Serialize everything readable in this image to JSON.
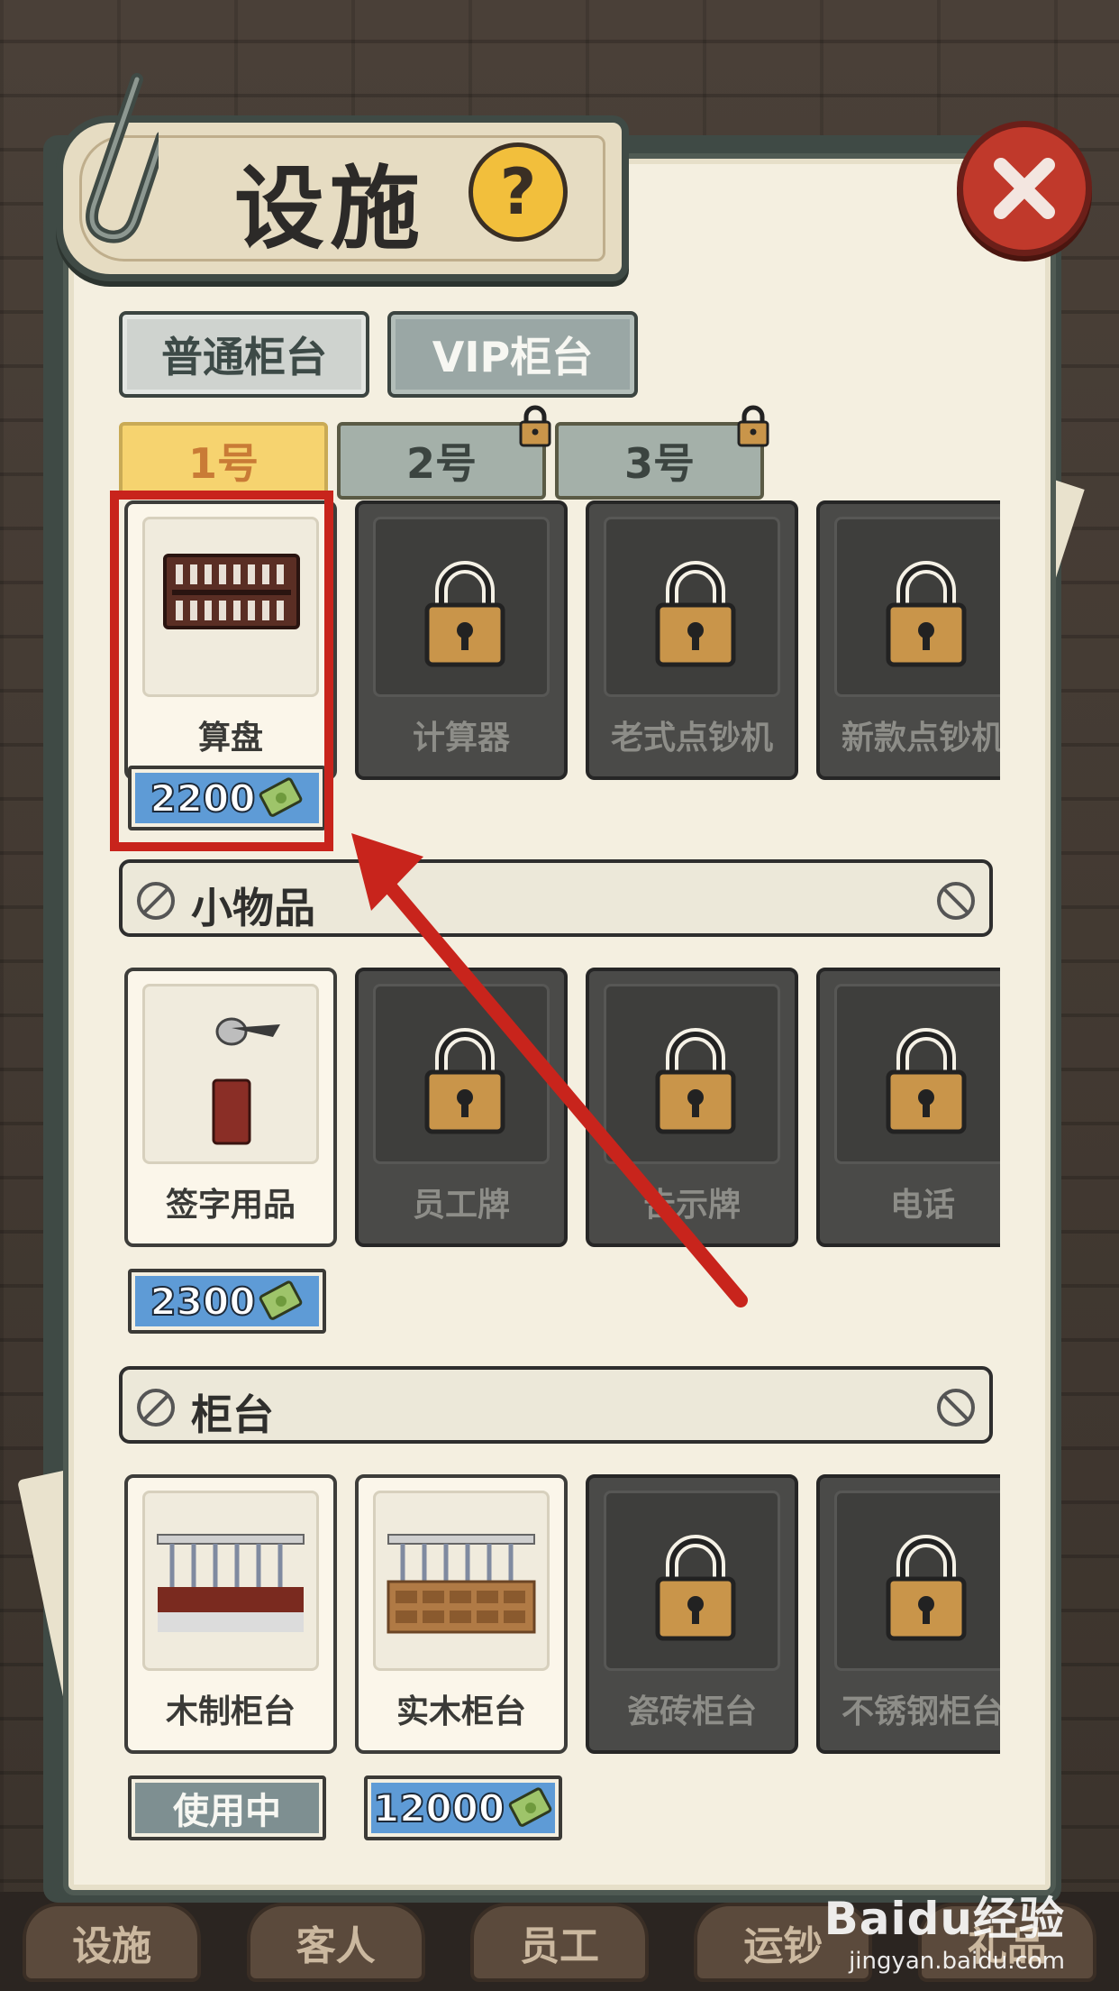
{
  "title": "设施",
  "help_label": "?",
  "category_tabs": [
    {
      "label": "普通柜台",
      "state": "selected"
    },
    {
      "label": "VIP柜台",
      "state": "unselected"
    }
  ],
  "counter_tabs": [
    {
      "label": "1号",
      "locked": false
    },
    {
      "label": "2号",
      "locked": true
    },
    {
      "label": "3号",
      "locked": true
    }
  ],
  "tools_row": {
    "items": [
      {
        "label": "算盘",
        "locked": false,
        "price": "2200"
      },
      {
        "label": "计算器",
        "locked": true
      },
      {
        "label": "老式点钞机",
        "locked": true
      },
      {
        "label": "新款点钞机",
        "locked": true
      }
    ]
  },
  "small_items_section": {
    "title": "小物品",
    "items": [
      {
        "label": "签字用品",
        "locked": false,
        "price": "2300"
      },
      {
        "label": "员工牌",
        "locked": true
      },
      {
        "label": "告示牌",
        "locked": true
      },
      {
        "label": "电话",
        "locked": true
      }
    ]
  },
  "counter_section": {
    "title": "柜台",
    "items": [
      {
        "label": "木制柜台",
        "locked": false,
        "status": "使用中"
      },
      {
        "label": "实木柜台",
        "locked": false,
        "price": "12000"
      },
      {
        "label": "瓷砖柜台",
        "locked": true
      },
      {
        "label": "不锈钢柜台",
        "locked": true
      }
    ]
  },
  "bottom_nav": [
    "设施",
    "客人",
    "员工",
    "运钞",
    "礼品"
  ],
  "watermark": {
    "logo": "Baidu经验",
    "url": "jingyan.baidu.com"
  },
  "colors": {
    "accent_red": "#c8241c",
    "price_blue": "#5e9bd6",
    "tab_selected": "#f6d36f"
  }
}
